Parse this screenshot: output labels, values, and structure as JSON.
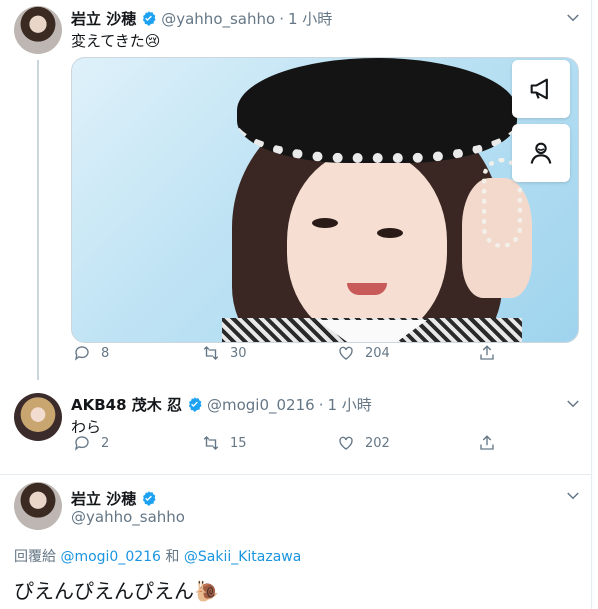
{
  "tweet1": {
    "name": "岩立 沙穂",
    "handle": "@yahho_sahho",
    "separator": "·",
    "time": "1 小時",
    "text": "変えてきた😢",
    "media_buttons": [
      "megaphone-icon",
      "profile-icon"
    ],
    "actions": {
      "replies": "8",
      "retweets": "30",
      "likes": "204"
    }
  },
  "tweet2": {
    "name": "AKB48 茂木 忍",
    "handle": "@mogi0_0216",
    "separator": "·",
    "time": "1 小時",
    "text": "わら",
    "actions": {
      "replies": "2",
      "retweets": "15",
      "likes": "202"
    }
  },
  "tweet3": {
    "name": "岩立 沙穂",
    "handle": "@yahho_sahho",
    "reply_prefix": "回覆給",
    "mention1": "@mogi0_0216",
    "reply_joiner": "和",
    "mention2": "@Sakii_Kitazawa",
    "text": "ぴえんぴえんぴえん🐌"
  },
  "colors": {
    "verified": "#1da1f2",
    "link": "#1b95e0",
    "secondary_text": "#657786",
    "border": "#e6ecf0"
  }
}
